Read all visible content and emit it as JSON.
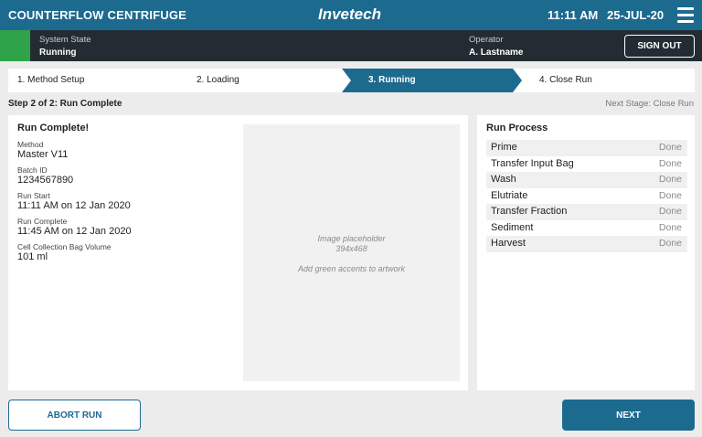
{
  "header": {
    "app_title": "COUNTERFLOW CENTRIFUGE",
    "brand": "Invetech",
    "time": "11:11 AM",
    "date": "25-JUL-20",
    "menu_icon": "hamburger-menu-icon",
    "color": "#1d6a8f"
  },
  "status": {
    "state_label": "System State",
    "state_value": "Running",
    "state_color": "#2fa34a",
    "operator_label": "Operator",
    "operator_value": "A. Lastname",
    "sign_out_label": "SIGN OUT"
  },
  "stepper": {
    "steps": [
      {
        "label": "1. Method Setup",
        "active": false
      },
      {
        "label": "2. Loading",
        "active": false
      },
      {
        "label": "3. Running",
        "active": true
      },
      {
        "label": "4. Close Run",
        "active": false
      }
    ]
  },
  "subheader": {
    "title": "Step 2 of 2: Run Complete",
    "next_stage": "Next Stage: Close Run"
  },
  "summary": {
    "title": "Run Complete!",
    "fields": [
      {
        "label": "Method",
        "value": "Master V11"
      },
      {
        "label": "Batch ID",
        "value": "1234567890"
      },
      {
        "label": "Run Start",
        "value": "11:11 AM on 12 Jan 2020"
      },
      {
        "label": "Run Complete",
        "value": "11:45 AM on 12 Jan 2020"
      },
      {
        "label": "Cell Collection Bag Volume",
        "value": "101 ml"
      }
    ]
  },
  "image_placeholder": {
    "line1": "Image placeholder",
    "line2": "394x468",
    "line3": "Add green accents to artwork"
  },
  "process": {
    "title": "Run Process",
    "rows": [
      {
        "name": "Prime",
        "status": "Done"
      },
      {
        "name": "Transfer Input Bag",
        "status": "Done"
      },
      {
        "name": "Wash",
        "status": "Done"
      },
      {
        "name": "Elutriate",
        "status": "Done"
      },
      {
        "name": "Transfer Fraction",
        "status": "Done"
      },
      {
        "name": "Sediment",
        "status": "Done"
      },
      {
        "name": "Harvest",
        "status": "Done"
      }
    ]
  },
  "actions": {
    "abort_label": "ABORT RUN",
    "next_label": "NEXT"
  }
}
